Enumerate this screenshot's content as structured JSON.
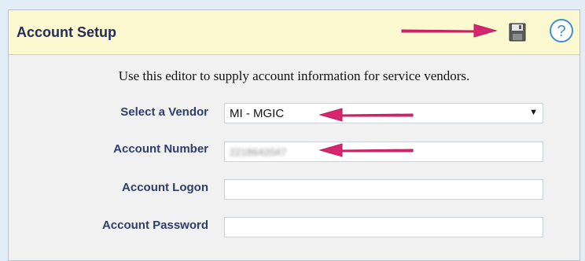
{
  "header": {
    "title": "Account Setup",
    "save_icon": "floppy-disk-icon",
    "help_icon": "help-question-icon"
  },
  "intro_text": "Use this editor to supply account information for service vendors.",
  "form": {
    "vendor": {
      "label": "Select a Vendor",
      "selected": "MI - MGIC"
    },
    "account_number": {
      "label": "Account Number",
      "value": "2218642047"
    },
    "account_logon": {
      "label": "Account Logon",
      "value": ""
    },
    "account_password": {
      "label": "Account Password",
      "value": ""
    }
  },
  "colors": {
    "header_bg": "#fcf8cf",
    "title": "#232d5c",
    "label": "#2e3e6a",
    "arrow": "#d8266e",
    "help_icon": "#3d8fd6"
  }
}
